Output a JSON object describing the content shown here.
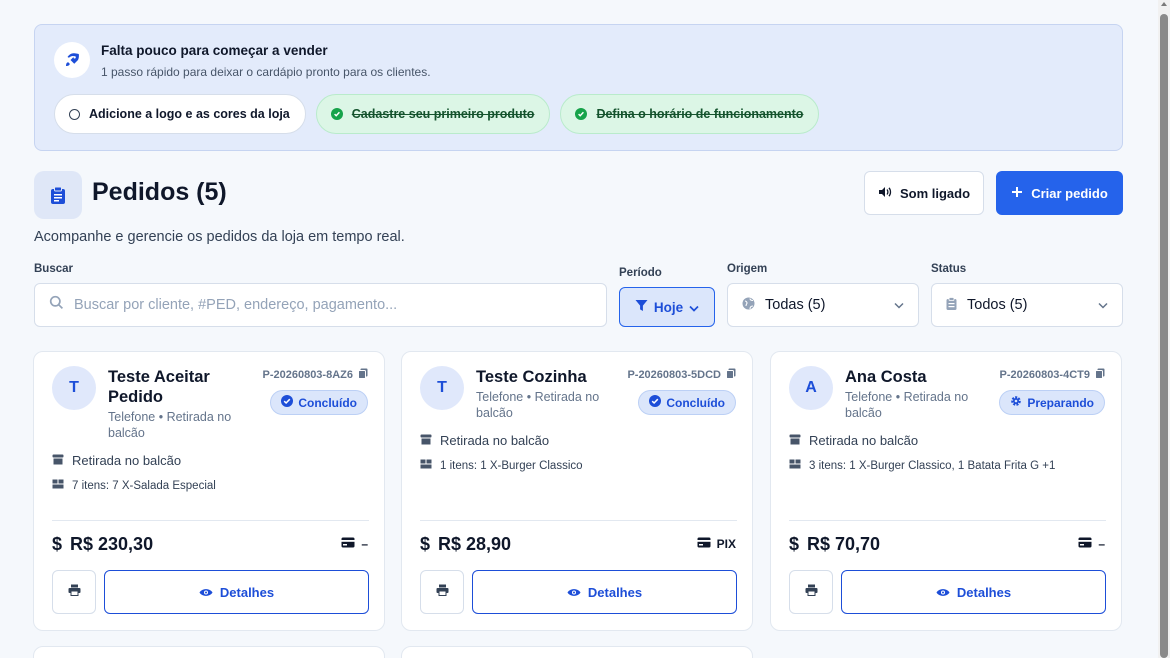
{
  "banner": {
    "title": "Falta pouco para começar a vender",
    "subtitle": "1 passo rápido para deixar o cardápio pronto para os clientes.",
    "steps": [
      {
        "label": "Adicione a logo e as cores da loja",
        "done": false
      },
      {
        "label": "Cadastre seu primeiro produto",
        "done": true
      },
      {
        "label": "Defina o horário de funcionamento",
        "done": true
      }
    ]
  },
  "header": {
    "title": "Pedidos (5)",
    "subtitle": "Acompanhe e gerencie os pedidos da loja em tempo real.",
    "sound_label": "Som ligado",
    "create_label": "Criar pedido"
  },
  "filters": {
    "search_label": "Buscar",
    "search_placeholder": "Buscar por cliente, #PED, endereço, pagamento...",
    "period_label": "Período",
    "period_value": "Hoje",
    "origin_label": "Origem",
    "origin_value": "Todas (5)",
    "status_label": "Status",
    "status_value": "Todos (5)"
  },
  "orders": [
    {
      "initial": "T",
      "name": "Teste Aceitar Pedido",
      "meta": "Telefone • Retirada no balcão",
      "code": "P-20260803-8AZ6",
      "status": "Concluído",
      "status_icon": "check-circle-icon",
      "delivery": "Retirada no balcão",
      "items": "7 itens: 7 X-Salada Especial",
      "total": "R$ 230,30",
      "payment": "–",
      "details_label": "Detalhes"
    },
    {
      "initial": "T",
      "name": "Teste Cozinha",
      "meta": "Telefone • Retirada no balcão",
      "code": "P-20260803-5DCD",
      "status": "Concluído",
      "status_icon": "check-circle-icon",
      "delivery": "Retirada no balcão",
      "items": "1 itens: 1 X-Burger Classico",
      "total": "R$ 28,90",
      "payment": "PIX",
      "details_label": "Detalhes"
    },
    {
      "initial": "A",
      "name": "Ana Costa",
      "meta": "Telefone • Retirada no balcão",
      "code": "P-20260803-4CT9",
      "status": "Preparando",
      "status_icon": "gear-icon",
      "delivery": "Retirada no balcão",
      "items": "3 itens: 1 X-Burger Classico, 1 Batata Frita G +1",
      "total": "R$ 70,70",
      "payment": "–",
      "details_label": "Detalhes"
    }
  ],
  "colors": {
    "accent": "#2563eb",
    "banner_bg": "#e3ebfb",
    "done_bg": "#dcf6e6",
    "done_check": "#16a34a"
  }
}
